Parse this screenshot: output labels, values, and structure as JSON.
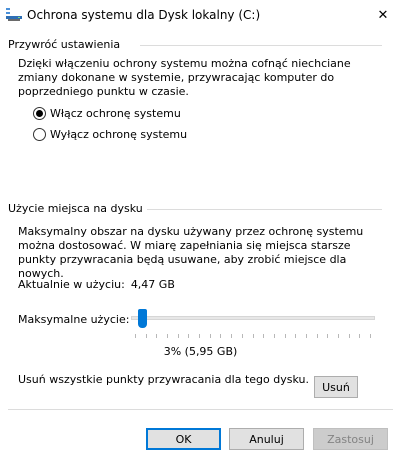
{
  "window": {
    "title": "Ochrona systemu dla Dysk lokalny (C:)",
    "close_glyph": "✕"
  },
  "restore_settings": {
    "group_title": "Przywróć ustawienia",
    "description": "Dzięki włączeniu ochrony systemu można cofnąć niechciane zmiany dokonane w systemie, przywracając komputer do poprzedniego punktu w czasie.",
    "options": [
      {
        "label": "Włącz ochronę systemu",
        "selected": true
      },
      {
        "label": "Wyłącz ochronę systemu",
        "selected": false
      }
    ]
  },
  "disk_usage": {
    "group_title": "Użycie miejsca na dysku",
    "description": "Maksymalny obszar na dysku używany przez ochronę systemu można dostosować. W miarę zapełniania się miejsca starsze punkty przywracania będą usuwane, aby zrobić miejsce dla nowych.",
    "current_label": "Aktualnie w użyciu:",
    "current_value": "4,47 GB",
    "max_label": "Maksymalne użycie:",
    "max_percent": 3,
    "max_value_text": "3% (5,95 GB)",
    "delete_text": "Usuń wszystkie punkty przywracania dla tego dysku.",
    "delete_button": "Usuń"
  },
  "footer": {
    "ok": "OK",
    "cancel": "Anuluj",
    "apply": "Zastosuj",
    "apply_enabled": false
  },
  "colors": {
    "accent": "#0078d7",
    "separator": "#dcdcdc",
    "button_face": "#e1e1e1",
    "disabled_text": "#838383"
  },
  "icons": {
    "app": "system-protection-icon",
    "close": "close-icon"
  }
}
